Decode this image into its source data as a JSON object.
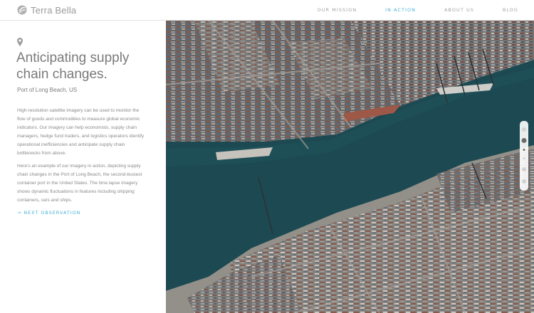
{
  "brand": {
    "name": "Terra Bella",
    "logo_icon": "terra-bella-logo-icon"
  },
  "nav": {
    "items": [
      {
        "label": "OUR MISSION",
        "active": false
      },
      {
        "label": "IN ACTION",
        "active": true
      },
      {
        "label": "ABOUT US",
        "active": false
      },
      {
        "label": "BLOG",
        "active": false
      }
    ]
  },
  "panel": {
    "icon": "location-pin-icon",
    "title": "Anticipating supply chain changes.",
    "location": "Port of Long Beach, US",
    "paragraph1": "High-resolution satellite imagery can be used to monitor the flow of goods and commodities to measure global economic indicators. Our imagery can help economists, supply chain managers, hedge fund traders, and logistics operators identify operational inefficiencies and anticipate supply chain bottlenecks from above.",
    "paragraph2": "Here's an example of our imagery in action, depicting supply chain changes in the Port of Long Beach, the second-busiest container port in the United States. The time lapse imagery shows dynamic fluctuations in features including shipping containers, cars and ships.",
    "next_label": "NEXT OBSERVATION",
    "next_icon": "arrow-right-icon"
  },
  "colors": {
    "accent": "#49b1d8",
    "water": "#1f4e56",
    "dock": "#8d8a84"
  },
  "timelapse": {
    "frames": 6,
    "current_frame": 2
  }
}
